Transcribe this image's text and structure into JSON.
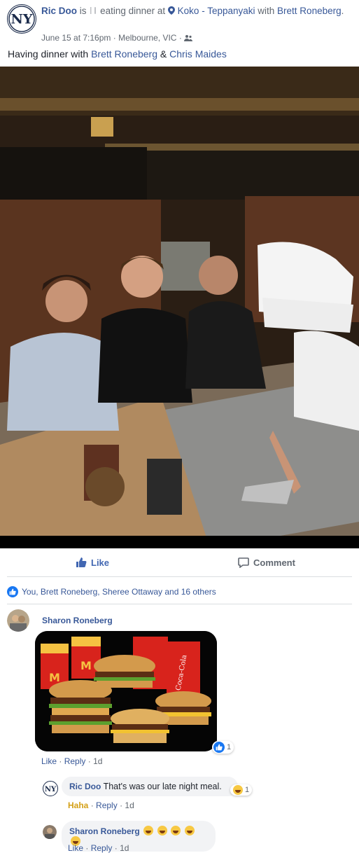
{
  "post": {
    "author": "Ric Doo",
    "is_text": "is",
    "activity": "eating dinner at",
    "place": "Koko - Teppanyaki",
    "with_text": "with",
    "with_name": "Brett Roneberg",
    "period": ".",
    "date": "June 15 at 7:16pm",
    "location": "Melbourne, VIC",
    "caption_prefix": "Having dinner with",
    "caption_person1": "Brett Roneberg",
    "caption_amp": "&",
    "caption_person2": "Chris Maides"
  },
  "actions": {
    "like_label": "Like",
    "comment_label": "Comment"
  },
  "reactions": {
    "summary": "You, Brett Roneberg, Sheree Ottaway and 16 others"
  },
  "comments": [
    {
      "author": "Sharon Roneberg",
      "reaction_count": "1",
      "like": "Like",
      "reply": "Reply",
      "time": "1d"
    },
    {
      "author": "Ric Doo",
      "text": "That's was our late night meal.",
      "reaction_count": "1",
      "haha": "Haha",
      "reply": "Reply",
      "time": "1d"
    },
    {
      "author": "Sharon Roneberg",
      "like": "Like",
      "reply": "Reply",
      "time": "1d"
    }
  ],
  "food_logo": "M",
  "food_cup_brand": "Coca-Cola",
  "colors": {
    "link": "#385898",
    "like_blue": "#4267b2",
    "divider": "#dadde1",
    "bubble": "#f2f3f5"
  }
}
